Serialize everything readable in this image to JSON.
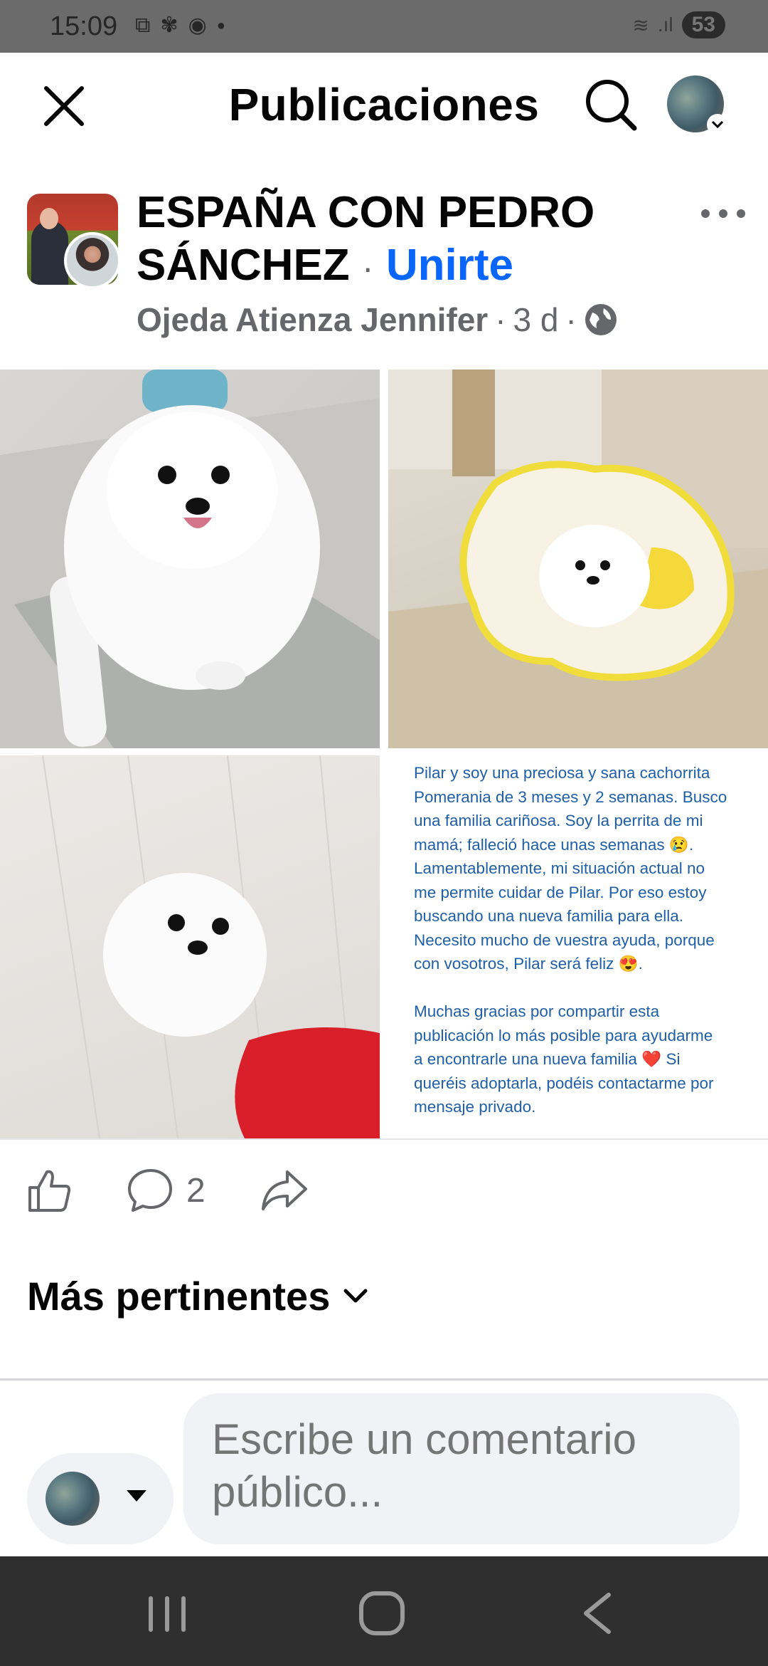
{
  "status_bar": {
    "time": "15:09",
    "battery": "53",
    "icons": [
      "screenshot-icon",
      "pinwheel-icon",
      "messenger-icon",
      "dot-icon",
      "wifi-icon",
      "signal-icon"
    ]
  },
  "header": {
    "title": "Publicaciones",
    "icons": [
      "close-icon",
      "search-icon",
      "profile-avatar"
    ]
  },
  "post": {
    "group_name": "ESPAÑA CON PEDRO SÁNCHEZ",
    "separator": "·",
    "join_label": "Unirte",
    "author": "Ojeda Atienza Jennifer",
    "time": "3 d",
    "visibility_icon": "globe-icon",
    "text": "Pilar y soy una preciosa y sana cachorrita\nPomerania de 3 meses y 2 semanas. Busco\nuna familia cariñosa. Soy la perrita de mi\nmamá; falleció hace unas semanas 😢.\nLamentablemente, mi situación actual no\nme permite cuidar de Pilar. Por eso estoy\nbuscando una nueva familia para ella.\nNecesito mucho de vuestra ayuda, porque\ncon vosotros, Pilar será feliz 😍.\n\nMuchas gracias por compartir esta\npublicación lo más posible para ayudarme\na encontrarle una nueva familia ❤️ Si\nqueréis adoptarla, podéis contactarme por\nmensaje privado.",
    "comment_count": "2"
  },
  "sort": {
    "label": "Más pertinentes"
  },
  "composer": {
    "placeholder": "Escribe un comentario público..."
  },
  "colors": {
    "accent": "#0866ff",
    "status_bar": "#6b6b6b",
    "nav_bar": "#2f2f2f",
    "post_text": "#1f5fa8"
  }
}
